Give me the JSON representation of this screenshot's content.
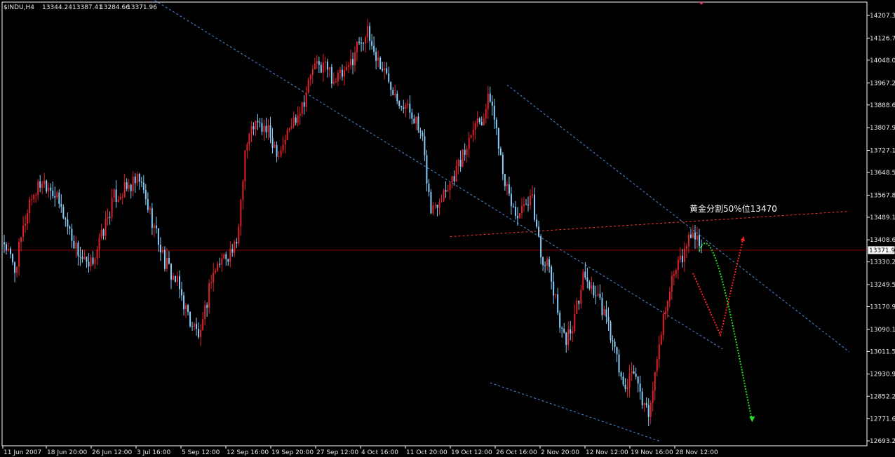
{
  "header": {
    "symbol": "$INDU,H4",
    "open": "13344.24",
    "high": "13387.41",
    "low": "13284.66",
    "close": "13371.96"
  },
  "current_price_label": "13371.96",
  "annotation": "黄金分割50%位13470",
  "colors": {
    "background": "#000000",
    "axis": "#ffffff",
    "bull_candle": "#e0202a",
    "bear_candle": "#87cefa",
    "channel_lines": "#4a90e2",
    "fib_line": "#ff3333",
    "price_line": "#8b0000",
    "scenario_red": "#ff2020",
    "scenario_green": "#22dd22",
    "marker": "#cc3366"
  },
  "chart_data": {
    "type": "candlestick",
    "title": "$INDU,H4",
    "ylim": [
      12693.2,
      14207.3
    ],
    "y_ticks": [
      "14207.3",
      "14126.7",
      "14048.0",
      "13967.2",
      "13888.6",
      "13807.9",
      "13727.1",
      "13648.5",
      "13567.8",
      "13489.1",
      "13408.6",
      "13330.2",
      "13249.5",
      "13170.9",
      "13090.1",
      "13011.5",
      "12930.9",
      "12852.2",
      "12771.6",
      "12693.2"
    ],
    "x_ticks": [
      "11 Jun 2007",
      "18 Jun 20:00",
      "26 Jun 12:00",
      "3 Jul 16:00",
      "5 Sep 12:00",
      "12 Sep 16:00",
      "19 Sep 20:00",
      "27 Sep 12:00",
      "4 Oct 16:00",
      "11 Oct 20:00",
      "19 Oct 12:00",
      "26 Oct 16:00",
      "2 Nov 20:00",
      "12 Nov 12:00",
      "19 Nov 16:00",
      "28 Nov 12:00"
    ],
    "current_price": 13371.96,
    "ohlc_keypoints": [
      [
        0,
        13400
      ],
      [
        5,
        13300
      ],
      [
        12,
        13550
      ],
      [
        18,
        13620
      ],
      [
        22,
        13600
      ],
      [
        28,
        13500
      ],
      [
        34,
        13380
      ],
      [
        40,
        13300
      ],
      [
        46,
        13420
      ],
      [
        52,
        13560
      ],
      [
        58,
        13590
      ],
      [
        64,
        13620
      ],
      [
        70,
        13480
      ],
      [
        76,
        13330
      ],
      [
        82,
        13250
      ],
      [
        88,
        13120
      ],
      [
        93,
        13060
      ],
      [
        98,
        13280
      ],
      [
        104,
        13350
      ],
      [
        110,
        13380
      ],
      [
        114,
        13730
      ],
      [
        118,
        13820
      ],
      [
        124,
        13800
      ],
      [
        130,
        13720
      ],
      [
        136,
        13820
      ],
      [
        142,
        13910
      ],
      [
        146,
        14020
      ],
      [
        152,
        14030
      ],
      [
        156,
        13980
      ],
      [
        162,
        14000
      ],
      [
        168,
        14120
      ],
      [
        172,
        14140
      ],
      [
        176,
        14060
      ],
      [
        182,
        13980
      ],
      [
        188,
        13900
      ],
      [
        194,
        13850
      ],
      [
        198,
        13750
      ],
      [
        202,
        13510
      ],
      [
        206,
        13560
      ],
      [
        212,
        13630
      ],
      [
        218,
        13720
      ],
      [
        222,
        13830
      ],
      [
        226,
        13840
      ],
      [
        230,
        13920
      ],
      [
        234,
        13760
      ],
      [
        238,
        13580
      ],
      [
        242,
        13500
      ],
      [
        246,
        13510
      ],
      [
        250,
        13550
      ],
      [
        254,
        13360
      ],
      [
        258,
        13300
      ],
      [
        262,
        13150
      ],
      [
        266,
        13050
      ],
      [
        270,
        13130
      ],
      [
        274,
        13280
      ],
      [
        278,
        13240
      ],
      [
        282,
        13180
      ],
      [
        286,
        13100
      ],
      [
        290,
        12980
      ],
      [
        294,
        12860
      ],
      [
        298,
        12950
      ],
      [
        302,
        12830
      ],
      [
        306,
        12800
      ],
      [
        310,
        13050
      ],
      [
        314,
        13220
      ],
      [
        318,
        13300
      ],
      [
        322,
        13360
      ],
      [
        326,
        13450
      ],
      [
        330,
        13372
      ]
    ],
    "channel_upper": [
      [
        0,
        14590
      ],
      [
        340,
        13020
      ]
    ],
    "channel_upper2": [
      [
        238,
        13960
      ],
      [
        400,
        13010
      ]
    ],
    "channel_lower": [
      [
        230,
        12900
      ],
      [
        310,
        12693
      ]
    ],
    "fib_line": [
      [
        211,
        13420
      ],
      [
        400,
        13510
      ]
    ],
    "fib_level": 13470,
    "scenario_red": [
      [
        326,
        13290
      ],
      [
        339,
        13070
      ],
      [
        350,
        13420
      ]
    ],
    "scenario_green": [
      [
        329,
        13370
      ],
      [
        347,
        13010
      ],
      [
        354,
        12765
      ]
    ]
  }
}
